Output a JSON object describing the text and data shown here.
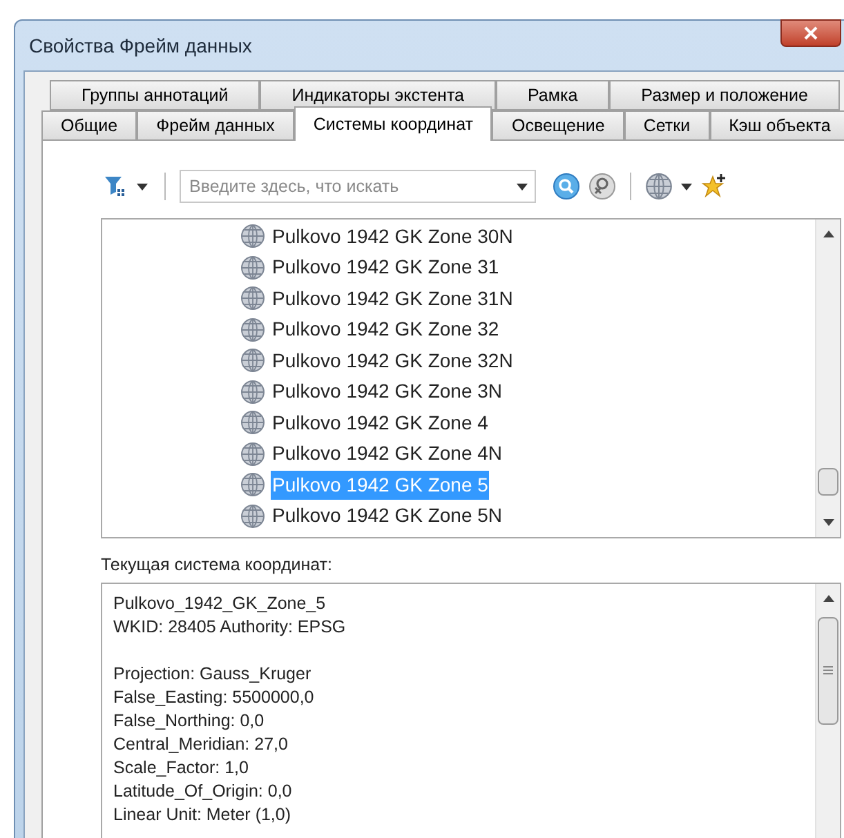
{
  "window": {
    "title": "Свойства Фрейм данных"
  },
  "tab_rows": [
    [
      {
        "label": "Группы аннотаций",
        "selected": false
      },
      {
        "label": "Индикаторы экстента",
        "selected": false
      },
      {
        "label": "Рамка",
        "selected": false
      },
      {
        "label": "Размер и положение",
        "selected": false
      }
    ],
    [
      {
        "label": "Общие",
        "selected": false
      },
      {
        "label": "Фрейм данных",
        "selected": false
      },
      {
        "label": "Системы координат",
        "selected": true
      },
      {
        "label": "Освещение",
        "selected": false
      },
      {
        "label": "Сетки",
        "selected": false
      },
      {
        "label": "Кэш объекта",
        "selected": false
      }
    ]
  ],
  "search": {
    "placeholder": "Введите здесь, что искать"
  },
  "coordinate_systems": [
    {
      "name": "Pulkovo 1942 GK Zone 30N",
      "selected": false
    },
    {
      "name": "Pulkovo 1942 GK Zone 31",
      "selected": false
    },
    {
      "name": "Pulkovo 1942 GK Zone 31N",
      "selected": false
    },
    {
      "name": "Pulkovo 1942 GK Zone 32",
      "selected": false
    },
    {
      "name": "Pulkovo 1942 GK Zone 32N",
      "selected": false
    },
    {
      "name": "Pulkovo 1942 GK Zone 3N",
      "selected": false
    },
    {
      "name": "Pulkovo 1942 GK Zone 4",
      "selected": false
    },
    {
      "name": "Pulkovo 1942 GK Zone 4N",
      "selected": false
    },
    {
      "name": "Pulkovo 1942 GK Zone 5",
      "selected": true
    },
    {
      "name": "Pulkovo 1942 GK Zone 5N",
      "selected": false
    }
  ],
  "current": {
    "label": "Текущая система координат:",
    "paragraphs": [
      [
        "Pulkovo_1942_GK_Zone_5",
        "WKID: 28405 Authority: EPSG"
      ],
      [
        "Projection: Gauss_Kruger",
        "False_Easting: 5500000,0",
        "False_Northing: 0,0",
        "Central_Meridian: 27,0",
        "Scale_Factor: 1,0",
        "Latitude_Of_Origin: 0,0",
        "Linear Unit: Meter (1,0)"
      ]
    ]
  }
}
